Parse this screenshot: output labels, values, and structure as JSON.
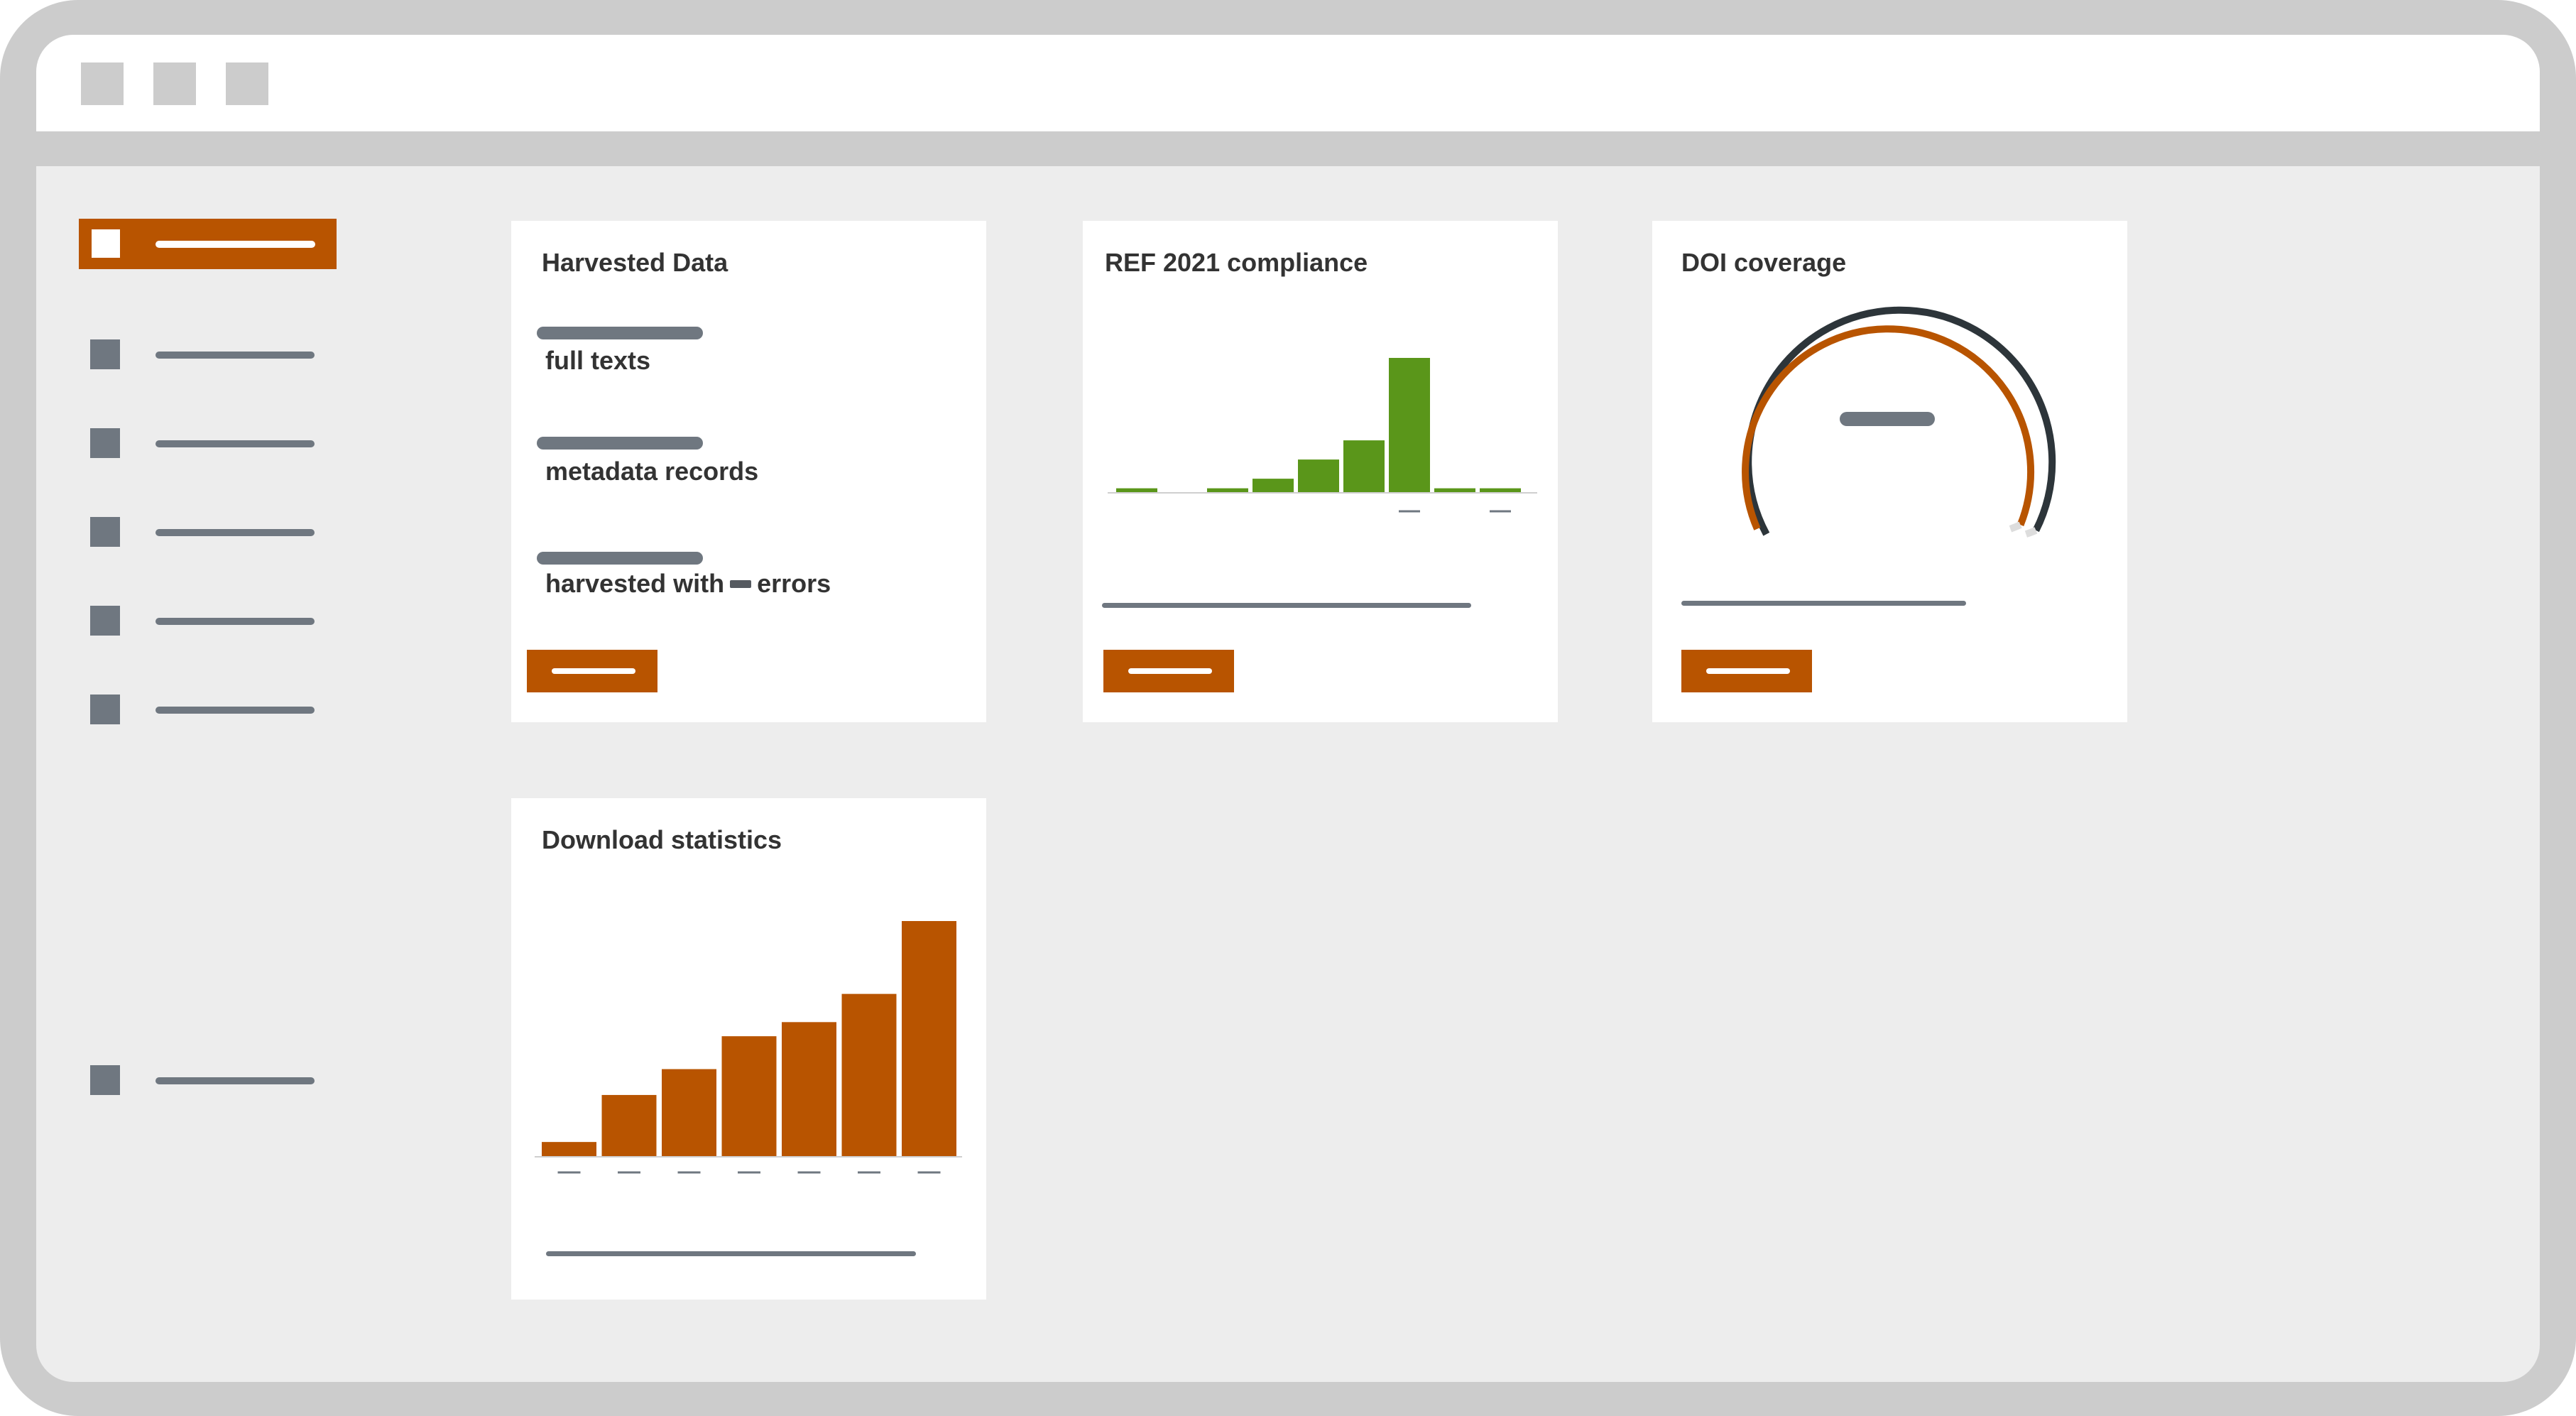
{
  "window": {
    "controls": [
      "window-control",
      "window-control",
      "window-control"
    ]
  },
  "sidebar": {
    "items": [
      {
        "name": "sidebar-item-1",
        "active": true
      },
      {
        "name": "sidebar-item-2",
        "active": false
      },
      {
        "name": "sidebar-item-3",
        "active": false
      },
      {
        "name": "sidebar-item-4",
        "active": false
      },
      {
        "name": "sidebar-item-5",
        "active": false
      },
      {
        "name": "sidebar-item-6",
        "active": false
      },
      {
        "name": "sidebar-item-7",
        "active": false
      }
    ]
  },
  "cards": {
    "harvested": {
      "title": "Harvested Data",
      "full_texts_label": "full texts",
      "metadata_label": "metadata records",
      "errors_prefix": "harvested with",
      "errors_suffix": "errors"
    },
    "ref": {
      "title": "REF 2021 compliance"
    },
    "doi": {
      "title": "DOI coverage"
    },
    "downloads": {
      "title": "Download statistics"
    }
  },
  "colors": {
    "accent": "#b85400",
    "green": "#5a961a",
    "gray": "#6f7780",
    "dark": "#2d353a"
  },
  "chart_data": [
    {
      "type": "bar",
      "chart": "ref-compliance",
      "values": [
        2,
        0,
        2,
        7,
        17,
        27,
        70,
        2,
        2
      ],
      "color": "#5a961a"
    },
    {
      "type": "bar",
      "chart": "download-statistics",
      "values": [
        6,
        26,
        37,
        51,
        57,
        69,
        100
      ],
      "color": "#b85400"
    }
  ]
}
